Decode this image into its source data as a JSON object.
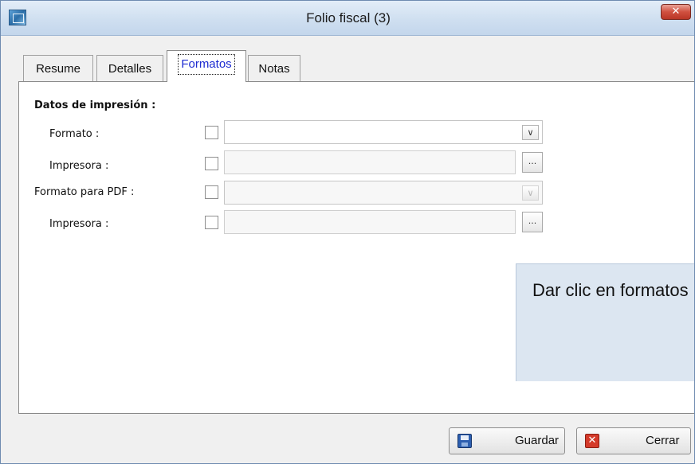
{
  "window": {
    "title": "Folio fiscal (3)",
    "close_glyph": "✕"
  },
  "tabs": [
    {
      "label": "Resume"
    },
    {
      "label": "Detalles"
    },
    {
      "label": "Formatos",
      "selected": true
    },
    {
      "label": "Notas"
    }
  ],
  "print_section": {
    "title": "Datos de impresión :",
    "rows": [
      {
        "label": "Formato :",
        "control": "select",
        "value": "",
        "checked": false,
        "enabled": true
      },
      {
        "label": "Impresora :",
        "control": "text-with-browse",
        "value": "",
        "checked": false,
        "enabled": false,
        "browse_label": "..."
      },
      {
        "label": "Formato para PDF :",
        "control": "select",
        "value": "",
        "checked": false,
        "enabled": false
      },
      {
        "label": "Impresora :",
        "control": "text-with-browse",
        "value": "",
        "checked": false,
        "enabled": false,
        "browse_label": "..."
      }
    ],
    "dropdown_glyph": "∨"
  },
  "callout": {
    "text": "Dar clic en formatos"
  },
  "buttons": {
    "save_label": "Guardar",
    "close_label": "Cerrar",
    "close_glyph": "✕"
  },
  "icons": {
    "app": "app-icon",
    "save": "floppy-disk-icon",
    "close": "close-icon"
  },
  "colors": {
    "selected_tab_text": "#1d2bd1",
    "titlebar": "#cfdff0",
    "callout_bg": "#dce6f1",
    "close_button": "#d0503f"
  }
}
